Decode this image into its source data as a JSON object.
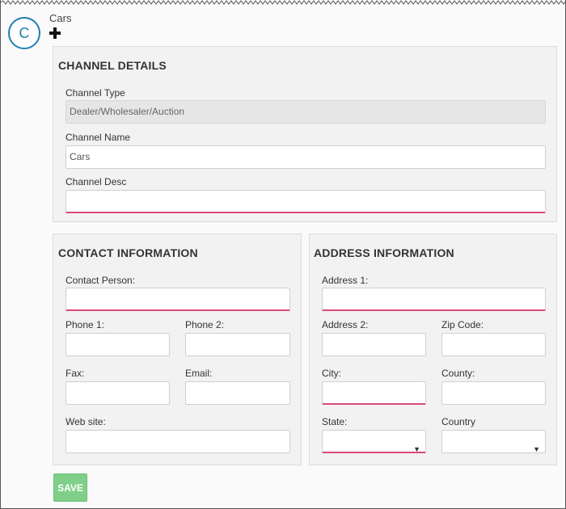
{
  "header": {
    "avatar_letter": "C",
    "title": "Cars"
  },
  "channel_details": {
    "title": "CHANNEL DETAILS",
    "type_label": "Channel Type",
    "type_value": "Dealer/Wholesaler/Auction",
    "name_label": "Channel Name",
    "name_value": "Cars",
    "desc_label": "Channel Desc",
    "desc_value": ""
  },
  "contact": {
    "title": "CONTACT INFORMATION",
    "person_label": "Contact Person:",
    "phone1_label": "Phone 1:",
    "phone2_label": "Phone 2:",
    "fax_label": "Fax:",
    "email_label": "Email:",
    "website_label": "Web site:"
  },
  "address": {
    "title": "ADDRESS INFORMATION",
    "address1_label": "Address 1:",
    "address2_label": "Address 2:",
    "zip_label": "Zip Code:",
    "city_label": "City:",
    "county_label": "County:",
    "state_label": "State:",
    "country_label": "Country",
    "state_value": "",
    "country_value": ""
  },
  "actions": {
    "save_label": "SAVE"
  },
  "colors": {
    "accent_blue": "#1f7fb0",
    "required_pink": "#d84a78",
    "save_green": "#7fcf88"
  }
}
